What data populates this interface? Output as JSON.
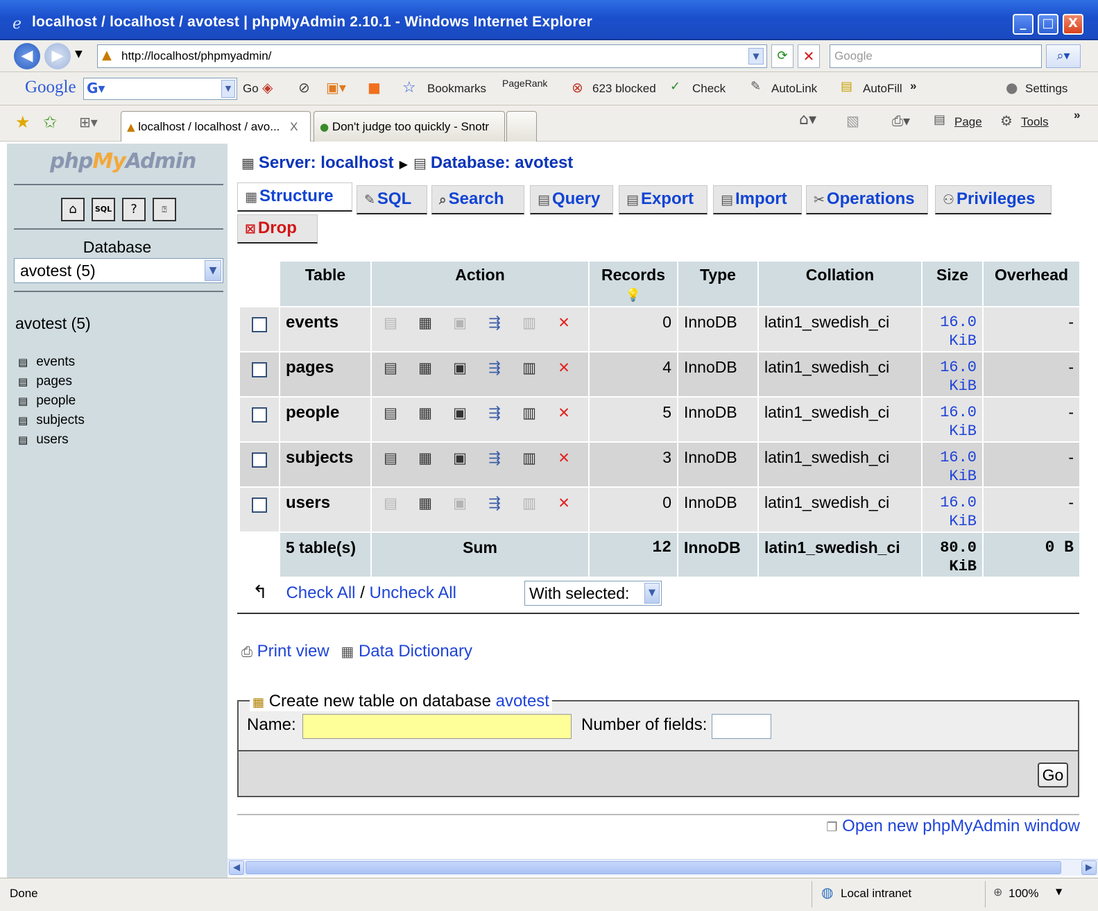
{
  "window": {
    "title": "localhost / localhost / avotest | phpMyAdmin 2.10.1 - Windows Internet Explorer",
    "minimize": "_",
    "maximize": "□",
    "close": "X"
  },
  "address_bar": {
    "url": "http://localhost/phpmyadmin/",
    "search_placeholder": "Google"
  },
  "google_toolbar": {
    "logo": "Google",
    "go": "Go",
    "bookmarks": "Bookmarks",
    "pagerank": "PageRank",
    "blocked": "623 blocked",
    "check": "Check",
    "autolink": "AutoLink",
    "autofill": "AutoFill",
    "more": "»",
    "settings": "Settings"
  },
  "browser_tabs": {
    "tab1": "localhost / localhost / avo...",
    "tab1_close": "X",
    "tab2": "Don't judge too quickly - Snotr",
    "page": "Page",
    "tools": "Tools",
    "more": "»"
  },
  "sidebar": {
    "logo_php": "php",
    "logo_my": "My",
    "logo_admin": "Admin",
    "database_label": "Database",
    "database_selected": "avotest (5)",
    "db_heading": "avotest (5)",
    "tables": [
      "events",
      "pages",
      "people",
      "subjects",
      "users"
    ]
  },
  "breadcrumb": {
    "server": "Server: localhost",
    "database": "Database: avotest"
  },
  "tabs": [
    {
      "label": "Structure"
    },
    {
      "label": "SQL"
    },
    {
      "label": "Search"
    },
    {
      "label": "Query"
    },
    {
      "label": "Export"
    },
    {
      "label": "Import"
    },
    {
      "label": "Operations"
    },
    {
      "label": "Privileges"
    },
    {
      "label": "Drop"
    }
  ],
  "table": {
    "headers": [
      "Table",
      "Action",
      "Records",
      "Type",
      "Collation",
      "Size",
      "Overhead"
    ],
    "rows": [
      {
        "name": "events",
        "records": "0",
        "type": "InnoDB",
        "collation": "latin1_swedish_ci",
        "size_value": "16.0",
        "size_unit": "KiB",
        "overhead": "-"
      },
      {
        "name": "pages",
        "records": "4",
        "type": "InnoDB",
        "collation": "latin1_swedish_ci",
        "size_value": "16.0",
        "size_unit": "KiB",
        "overhead": "-"
      },
      {
        "name": "people",
        "records": "5",
        "type": "InnoDB",
        "collation": "latin1_swedish_ci",
        "size_value": "16.0",
        "size_unit": "KiB",
        "overhead": "-"
      },
      {
        "name": "subjects",
        "records": "3",
        "type": "InnoDB",
        "collation": "latin1_swedish_ci",
        "size_value": "16.0",
        "size_unit": "KiB",
        "overhead": "-"
      },
      {
        "name": "users",
        "records": "0",
        "type": "InnoDB",
        "collation": "latin1_swedish_ci",
        "size_value": "16.0",
        "size_unit": "KiB",
        "overhead": "-"
      }
    ],
    "summary": {
      "tables": "5 table(s)",
      "sum": "Sum",
      "records": "12",
      "type": "InnoDB",
      "collation": "latin1_swedish_ci",
      "size_value": "80.0",
      "size_unit": "KiB",
      "overhead": "0 B"
    }
  },
  "bulk": {
    "check_all": "Check All",
    "slash": "/",
    "uncheck_all": "Uncheck All",
    "with_selected": "With selected:"
  },
  "links": {
    "print_view": "Print view",
    "data_dictionary": "Data Dictionary",
    "open_window": "Open new phpMyAdmin window"
  },
  "create_table": {
    "legend_prefix": "Create new table on database",
    "legend_db": "avotest",
    "name_label": "Name:",
    "fields_label": "Number of fields:",
    "go": "Go"
  },
  "status_bar": {
    "status": "Done",
    "zone": "Local intranet",
    "zoom": "100%"
  },
  "colors": {
    "sidebar_bg": "#d0dce0",
    "link": "#1f44d8",
    "drop": "#d21616",
    "titlebar": "#1b4fcb"
  }
}
